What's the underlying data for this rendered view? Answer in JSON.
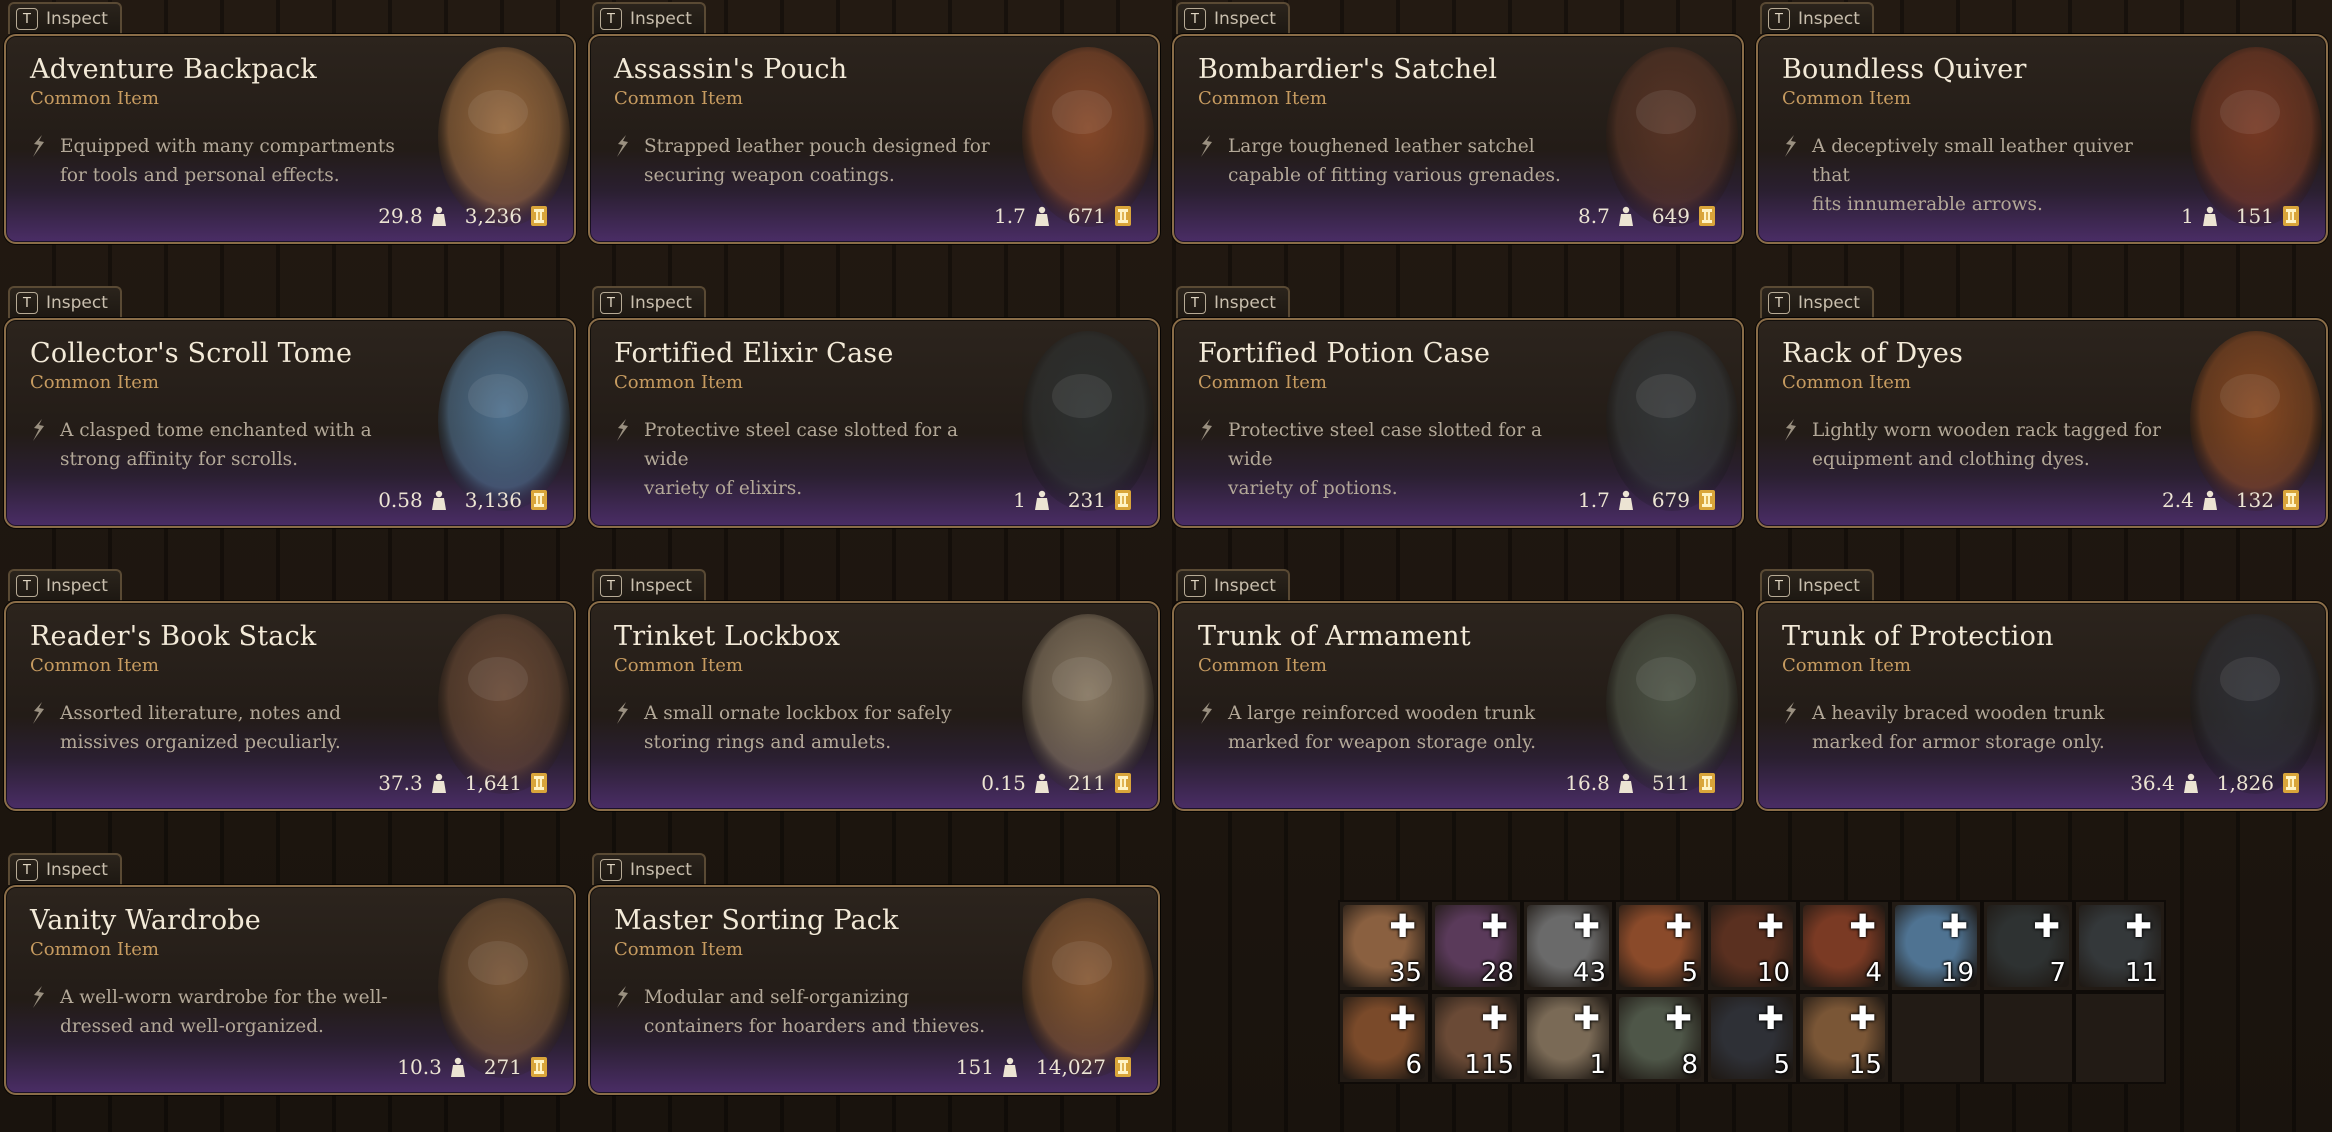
{
  "inspect_label": "Inspect",
  "inspect_key": "T",
  "cards": [
    {
      "title": "Adventure Backpack",
      "rarity": "Common Item",
      "desc1": "Equipped with many compartments",
      "desc2": "for tools and personal effects.",
      "weight": "29.8",
      "value": "3,236",
      "art": "backpack-icon",
      "color": "#9a6a3e"
    },
    {
      "title": "Assassin's Pouch",
      "rarity": "Common Item",
      "desc1": "Strapped leather pouch designed for",
      "desc2": "securing weapon coatings.",
      "weight": "1.7",
      "value": "671",
      "art": "pouch-icon",
      "color": "#8a4a2a"
    },
    {
      "title": "Bombardier's Satchel",
      "rarity": "Common Item",
      "desc1": "Large toughened leather satchel",
      "desc2": "capable of fitting various grenades.",
      "weight": "8.7",
      "value": "649",
      "art": "satchel-icon",
      "color": "#5a3526"
    },
    {
      "title": "Boundless Quiver",
      "rarity": "Common Item",
      "desc1": "A deceptively small leather quiver that",
      "desc2": "fits innumerable arrows.",
      "weight": "1",
      "value": "151",
      "art": "quiver-icon",
      "color": "#7a3a24"
    },
    {
      "title": "Collector's Scroll Tome",
      "rarity": "Common Item",
      "desc1": "A clasped tome enchanted with a",
      "desc2": "strong affinity for scrolls.",
      "weight": "0.58",
      "value": "3,136",
      "art": "tome-icon",
      "color": "#4f7392"
    },
    {
      "title": "Fortified Elixir Case",
      "rarity": "Common Item",
      "desc1": "Protective steel case slotted for a wide",
      "desc2": "variety of elixirs.",
      "weight": "1",
      "value": "231",
      "art": "elixir-case-icon",
      "color": "#2e3232"
    },
    {
      "title": "Fortified Potion Case",
      "rarity": "Common Item",
      "desc1": "Protective steel case slotted for a wide",
      "desc2": "variety of potions.",
      "weight": "1.7",
      "value": "679",
      "art": "potion-case-icon",
      "color": "#34383a"
    },
    {
      "title": "Rack of Dyes",
      "rarity": "Common Item",
      "desc1": "Lightly worn wooden rack tagged for",
      "desc2": "equipment and clothing dyes.",
      "weight": "2.4",
      "value": "132",
      "art": "dye-rack-icon",
      "color": "#8a4a22"
    },
    {
      "title": "Reader's Book Stack",
      "rarity": "Common Item",
      "desc1": "Assorted literature, notes and",
      "desc2": "missives organized peculiarly.",
      "weight": "37.3",
      "value": "1,641",
      "art": "book-stack-icon",
      "color": "#6a4a36"
    },
    {
      "title": "Trinket Lockbox",
      "rarity": "Common Item",
      "desc1": "A small ornate lockbox for safely",
      "desc2": "storing rings and amulets.",
      "weight": "0.15",
      "value": "211",
      "art": "lockbox-icon",
      "color": "#8a7a64"
    },
    {
      "title": "Trunk of Armament",
      "rarity": "Common Item",
      "desc1": "A large reinforced wooden trunk",
      "desc2": "marked for weapon storage only.",
      "weight": "16.8",
      "value": "511",
      "art": "armament-trunk-icon",
      "color": "#4e5648"
    },
    {
      "title": "Trunk of Protection",
      "rarity": "Common Item",
      "desc1": "A heavily braced wooden trunk",
      "desc2": "marked for armor storage only.",
      "weight": "36.4",
      "value": "1,826",
      "art": "protection-trunk-icon",
      "color": "#2e3036"
    },
    {
      "title": "Vanity Wardrobe",
      "rarity": "Common Item",
      "desc1": "A well-worn wardrobe for the well-",
      "desc2": "dressed and well-organized.",
      "weight": "10.3",
      "value": "271",
      "art": "wardrobe-icon",
      "color": "#7a5636"
    },
    {
      "title": "Master Sorting Pack",
      "rarity": "Common Item",
      "desc1": "Modular and self-organizing",
      "desc2": "containers for hoarders and thieves.",
      "weight": "151",
      "value": "14,027",
      "art": "sorting-pack-icon",
      "color": "#8a5a34"
    }
  ],
  "inventory": [
    {
      "count": "35",
      "plus": true,
      "color": "#8a6040",
      "icon": "backpack-icon"
    },
    {
      "count": "28",
      "plus": true,
      "color": "#5a3a5a",
      "icon": "satchel-icon"
    },
    {
      "count": "43",
      "plus": true,
      "color": "#6a6a6a",
      "icon": "keyring-icon"
    },
    {
      "count": "5",
      "plus": true,
      "color": "#8a4a2a",
      "icon": "pouch-icon"
    },
    {
      "count": "10",
      "plus": true,
      "color": "#5a3020",
      "icon": "satchel-icon"
    },
    {
      "count": "4",
      "plus": true,
      "color": "#7a3a24",
      "icon": "quiver-icon"
    },
    {
      "count": "19",
      "plus": true,
      "color": "#4f7392",
      "icon": "tome-icon"
    },
    {
      "count": "7",
      "plus": true,
      "color": "#2e3232",
      "icon": "elixir-case-icon"
    },
    {
      "count": "11",
      "plus": true,
      "color": "#34383a",
      "icon": "potion-case-icon"
    },
    {
      "count": "6",
      "plus": true,
      "color": "#7a4a2a",
      "icon": "dye-rack-icon"
    },
    {
      "count": "115",
      "plus": true,
      "color": "#6a4a36",
      "icon": "book-stack-icon"
    },
    {
      "count": "1",
      "plus": true,
      "color": "#7a6a56",
      "icon": "lockbox-icon"
    },
    {
      "count": "8",
      "plus": true,
      "color": "#4e5648",
      "icon": "armament-trunk-icon"
    },
    {
      "count": "5",
      "plus": true,
      "color": "#2e3036",
      "icon": "protection-trunk-icon"
    },
    {
      "count": "15",
      "plus": true,
      "color": "#7a5636",
      "icon": "wardrobe-icon"
    },
    {
      "count": "",
      "plus": false,
      "color": "",
      "icon": ""
    },
    {
      "count": "",
      "plus": false,
      "color": "",
      "icon": ""
    },
    {
      "count": "",
      "plus": false,
      "color": "",
      "icon": ""
    }
  ],
  "colors": {
    "title": "#f3ead8",
    "rarity": "#c69b60",
    "desc": "#b3a898",
    "border": "#8a6d48",
    "purple": "#4a2d66"
  }
}
